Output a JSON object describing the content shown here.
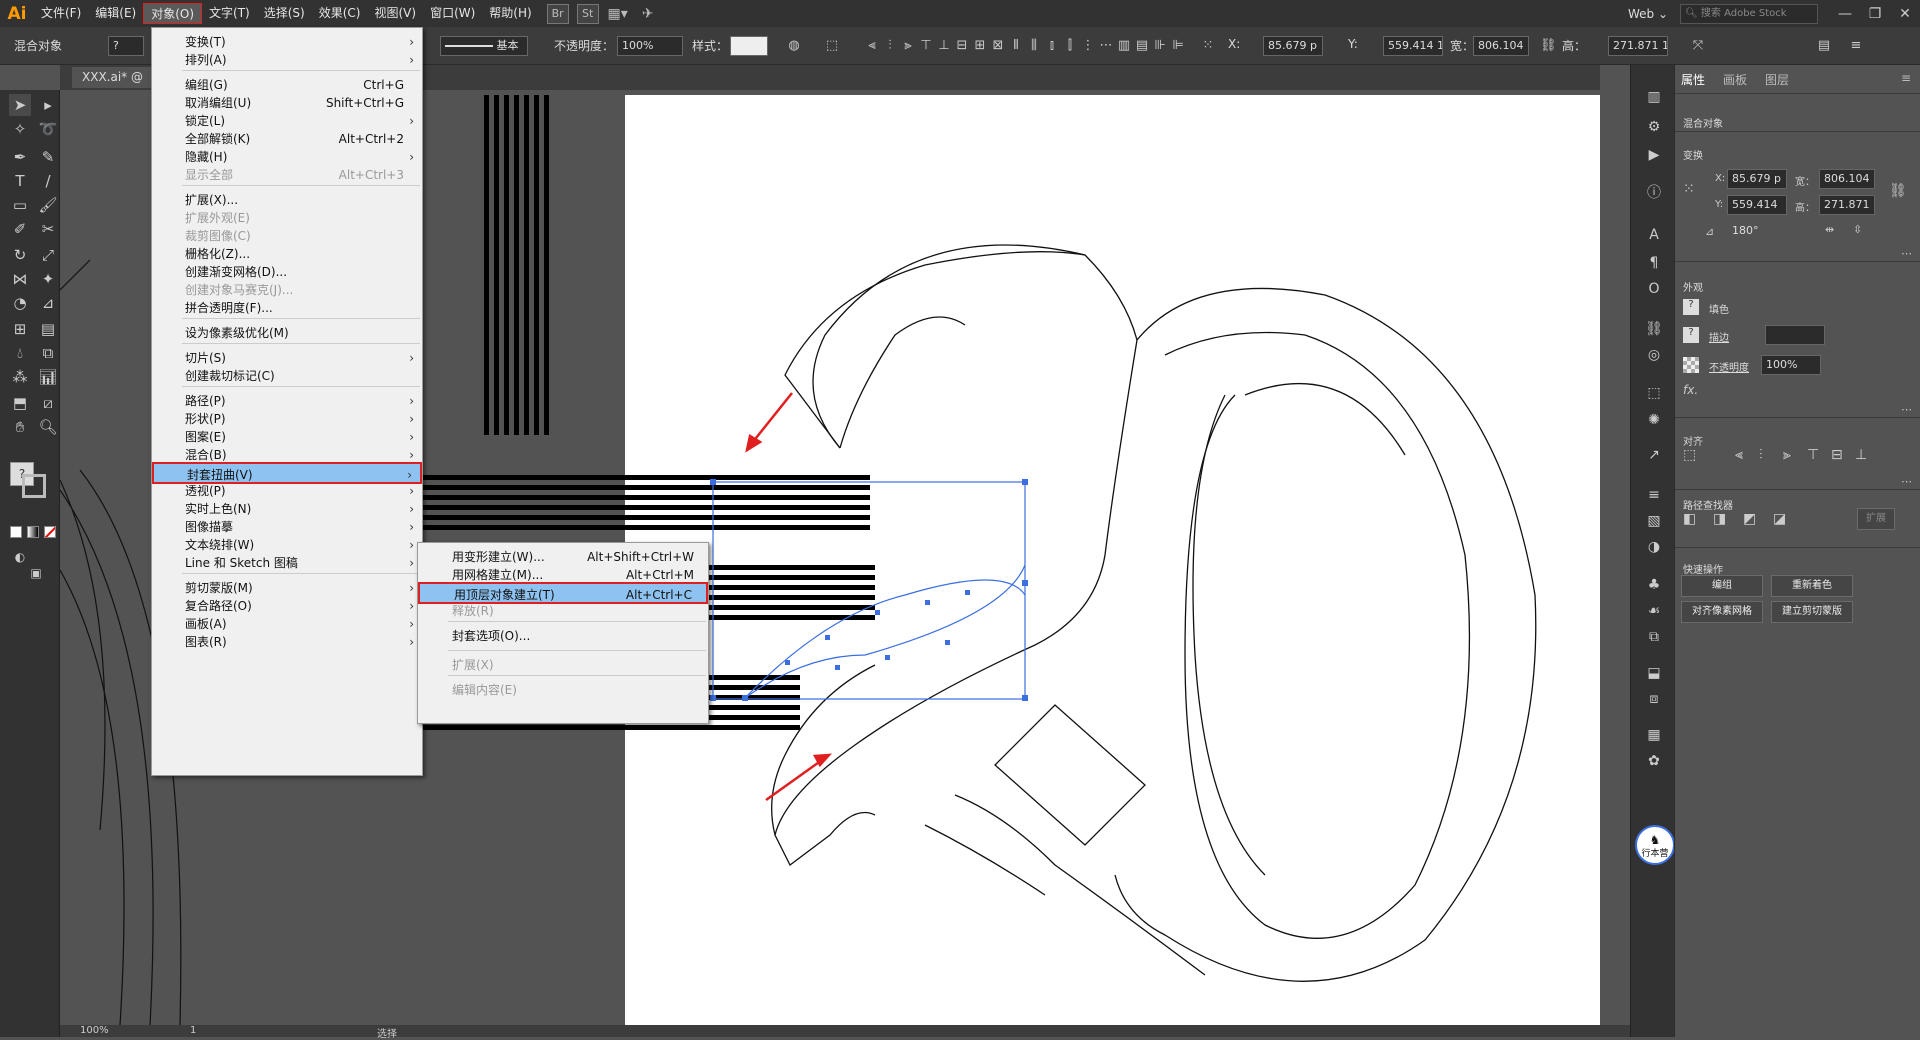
{
  "menubar": {
    "items": [
      "文件(F)",
      "编辑(E)",
      "对象(O)",
      "文字(T)",
      "选择(S)",
      "效果(C)",
      "视图(V)",
      "窗口(W)",
      "帮助(H)"
    ],
    "open_index": 2,
    "br": "Br",
    "st": "St",
    "workspace": "Web",
    "search_placeholder": "搜索 Adobe Stock"
  },
  "control": {
    "object_type": "混合对象",
    "stroke_label": "基本",
    "opacity_label": "不透明度：",
    "opacity": "100%",
    "style_label": "样式：",
    "x_label": "X:",
    "x": "85.679 p",
    "y_label": "Y:",
    "y": "559.414 1",
    "w_label": "宽：",
    "w": "806.104",
    "h_label": "高：",
    "h": "271.871 1"
  },
  "document": {
    "tab": "XXX.ai* @ "
  },
  "object_menu": [
    {
      "label": "变换(T)",
      "shortcut": "",
      "submenu": true,
      "disabled": false
    },
    {
      "label": "排列(A)",
      "shortcut": "",
      "submenu": true,
      "disabled": false
    },
    {
      "sep": true
    },
    {
      "label": "编组(G)",
      "shortcut": "Ctrl+G",
      "submenu": false,
      "disabled": false
    },
    {
      "label": "取消编组(U)",
      "shortcut": "Shift+Ctrl+G",
      "submenu": false,
      "disabled": false
    },
    {
      "label": "锁定(L)",
      "shortcut": "",
      "submenu": true,
      "disabled": false
    },
    {
      "label": "全部解锁(K)",
      "shortcut": "Alt+Ctrl+2",
      "submenu": false,
      "disabled": false
    },
    {
      "label": "隐藏(H)",
      "shortcut": "",
      "submenu": true,
      "disabled": false
    },
    {
      "label": "显示全部",
      "shortcut": "Alt+Ctrl+3",
      "submenu": false,
      "disabled": true
    },
    {
      "sep": true
    },
    {
      "label": "扩展(X)...",
      "shortcut": "",
      "submenu": false,
      "disabled": false
    },
    {
      "label": "扩展外观(E)",
      "shortcut": "",
      "submenu": false,
      "disabled": true
    },
    {
      "label": "裁剪图像(C)",
      "shortcut": "",
      "submenu": false,
      "disabled": true
    },
    {
      "label": "栅格化(Z)...",
      "shortcut": "",
      "submenu": false,
      "disabled": false
    },
    {
      "label": "创建渐变网格(D)...",
      "shortcut": "",
      "submenu": false,
      "disabled": false
    },
    {
      "label": "创建对象马赛克(J)...",
      "shortcut": "",
      "submenu": false,
      "disabled": true
    },
    {
      "label": "拼合透明度(F)...",
      "shortcut": "",
      "submenu": false,
      "disabled": false
    },
    {
      "sep": true
    },
    {
      "label": "设为像素级优化(M)",
      "shortcut": "",
      "submenu": false,
      "disabled": false
    },
    {
      "sep": true
    },
    {
      "label": "切片(S)",
      "shortcut": "",
      "submenu": true,
      "disabled": false
    },
    {
      "label": "创建裁切标记(C)",
      "shortcut": "",
      "submenu": false,
      "disabled": false
    },
    {
      "sep": true
    },
    {
      "label": "路径(P)",
      "shortcut": "",
      "submenu": true,
      "disabled": false
    },
    {
      "label": "形状(P)",
      "shortcut": "",
      "submenu": true,
      "disabled": false
    },
    {
      "label": "图案(E)",
      "shortcut": "",
      "submenu": true,
      "disabled": false
    },
    {
      "label": "混合(B)",
      "shortcut": "",
      "submenu": true,
      "disabled": false
    },
    {
      "label": "封套扭曲(V)",
      "shortcut": "",
      "submenu": true,
      "disabled": false,
      "highlight": true
    },
    {
      "label": "透视(P)",
      "shortcut": "",
      "submenu": true,
      "disabled": false
    },
    {
      "label": "实时上色(N)",
      "shortcut": "",
      "submenu": true,
      "disabled": false
    },
    {
      "label": "图像描摹",
      "shortcut": "",
      "submenu": true,
      "disabled": false
    },
    {
      "label": "文本绕排(W)",
      "shortcut": "",
      "submenu": true,
      "disabled": false
    },
    {
      "label": "Line 和 Sketch 图稿",
      "shortcut": "",
      "submenu": true,
      "disabled": false
    },
    {
      "sep": true
    },
    {
      "label": "剪切蒙版(M)",
      "shortcut": "",
      "submenu": true,
      "disabled": false
    },
    {
      "label": "复合路径(O)",
      "shortcut": "",
      "submenu": true,
      "disabled": false
    },
    {
      "label": "画板(A)",
      "shortcut": "",
      "submenu": true,
      "disabled": false
    },
    {
      "label": "图表(R)",
      "shortcut": "",
      "submenu": true,
      "disabled": false
    }
  ],
  "envelope_menu": [
    {
      "label": "用变形建立(W)...",
      "shortcut": "Alt+Shift+Ctrl+W",
      "disabled": false
    },
    {
      "label": "用网格建立(M)...",
      "shortcut": "Alt+Ctrl+M",
      "disabled": false
    },
    {
      "label": "用顶层对象建立(T)",
      "shortcut": "Alt+Ctrl+C",
      "disabled": false,
      "highlight": true
    },
    {
      "label": "释放(R)",
      "shortcut": "",
      "disabled": true
    },
    {
      "sep": true
    },
    {
      "label": "封套选项(O)...",
      "shortcut": "",
      "disabled": false
    },
    {
      "sep": true
    },
    {
      "label": "扩展(X)",
      "shortcut": "",
      "disabled": true
    },
    {
      "sep": true
    },
    {
      "label": "编辑内容(E)",
      "shortcut": "",
      "disabled": true
    }
  ],
  "panel": {
    "tabs": [
      "属性",
      "画板",
      "图层"
    ],
    "object_type": "混合对象",
    "transform_title": "变换",
    "x_label": "X:",
    "x": "85.679 p",
    "y_label": "Y:",
    "y": "559.414",
    "w_label": "宽：",
    "w": "806.104",
    "h_label": "高：",
    "h": "271.871",
    "angle": "180°",
    "appearance_title": "外观",
    "fill_label": "填色",
    "stroke_label": "描边",
    "opacity_label": "不透明度",
    "opacity": "100%",
    "fx": "fx.",
    "align_title": "对齐",
    "pathfinder_title": "路径查找器",
    "pathfinder_btn": "扩展",
    "quick_title": "快速操作",
    "btn_group": "编组",
    "btn_recolor": "重新着色",
    "btn_pixel_align": "对齐像素网格",
    "btn_clip_mask": "建立剪切蒙版"
  },
  "status": {
    "zoom": "100%",
    "artboard": "1",
    "tool": "选择"
  },
  "watermark": {
    "text": "行本营",
    "badge": "英"
  },
  "colors": {
    "accent_blue": "#8ec2f0",
    "highlight_red": "#e02020",
    "selection_blue": "#3b6fe0",
    "logo_orange": "#ff9a00"
  }
}
